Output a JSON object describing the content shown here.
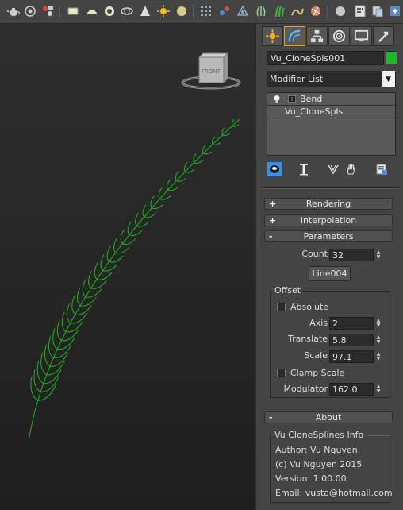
{
  "toolbar": {
    "icons": [
      "teapot-icon",
      "sphere-gizmo-icon",
      "render-setup-icon",
      "box-icon",
      "dome-icon",
      "ring-icon",
      "cylinder-icon",
      "cone-icon",
      "sun-icon",
      "sphere-icon",
      "grid-icon",
      "dots-icon",
      "particle-icon",
      "plant-icon",
      "hair-icon",
      "terrain-icon",
      "ball-icon",
      "calendar-icon",
      "copy-icon",
      "settings-icon"
    ]
  },
  "viewport": {
    "viewcube_label": "FRONT",
    "spline_color": "#1db41d"
  },
  "panel": {
    "tabs": [
      "create-icon",
      "modify-icon",
      "hierarchy-icon",
      "motion-icon",
      "display-icon",
      "utilities-icon"
    ],
    "object_name": "Vu_CloneSpls001",
    "object_color": "#1fb62c",
    "modifier_list_label": "Modifier List",
    "stack": {
      "items": [
        {
          "label": "Bend",
          "expander": "+"
        },
        {
          "label": "Vu_CloneSpls"
        }
      ]
    },
    "rollouts": {
      "rendering": {
        "sign": "+",
        "label": "Rendering"
      },
      "interpolation": {
        "sign": "+",
        "label": "Interpolation"
      },
      "parameters": {
        "sign": "-",
        "label": "Parameters"
      },
      "about": {
        "sign": "-",
        "label": "About"
      }
    },
    "parameters": {
      "count_label": "Count",
      "count_value": "32",
      "pick_button": "Line004",
      "offset_group": "Offset",
      "absolute_label": "Absolute",
      "axis_label": "Axis",
      "axis_value": "2",
      "translate_label": "Translate",
      "translate_value": "5.8",
      "scale_label": "Scale",
      "scale_value": "97.1",
      "clamp_scale_label": "Clamp Scale",
      "modulator_label": "Modulator",
      "modulator_value": "162.0"
    },
    "about": {
      "group_title": "Vu CloneSplines Info",
      "author": "Author: Vu Nguyen",
      "copyright": "(c) Vu Nguyen 2015",
      "version": "Version: 1.00.00",
      "email": "Email: vusta@hotmail.com"
    }
  }
}
